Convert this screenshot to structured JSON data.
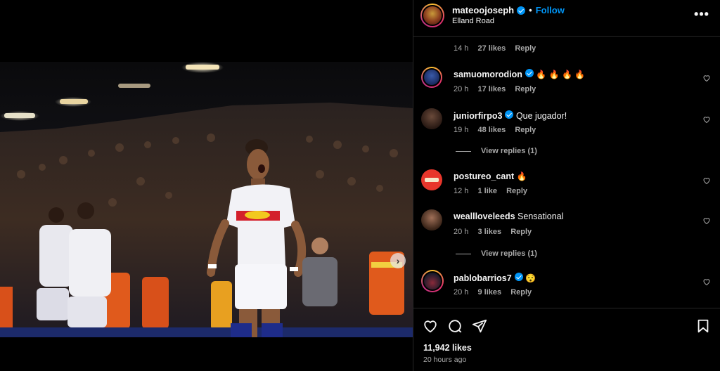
{
  "post": {
    "username": "mateoojoseph",
    "location": "Elland Road",
    "follow_label": "Follow",
    "separator": "•",
    "more_label": "•••",
    "likes_text": "11,942 likes",
    "time_ago": "20 hours ago"
  },
  "media": {
    "next_label": "›",
    "dot_count": 5,
    "active_dot": 0
  },
  "comments": [
    {
      "username": "",
      "text": "",
      "time": "14 h",
      "likes": "27 likes",
      "reply": "Reply",
      "partial": true
    },
    {
      "username": "samuomorodion",
      "verified": true,
      "text": "🔥 🔥 🔥 🔥",
      "time": "20 h",
      "likes": "17 likes",
      "reply": "Reply"
    },
    {
      "username": "juniorfirpo3",
      "verified": true,
      "text": "Que jugador!",
      "time": "19 h",
      "likes": "48 likes",
      "reply": "Reply",
      "view_replies": "View replies (1)"
    },
    {
      "username": "postureo_cant",
      "verified": false,
      "text": "🔥",
      "time": "12 h",
      "likes": "1 like",
      "reply": "Reply"
    },
    {
      "username": "weallloveleeds",
      "verified": false,
      "text": "Sensational",
      "time": "20 h",
      "likes": "3 likes",
      "reply": "Reply",
      "view_replies": "View replies (1)"
    },
    {
      "username": "pablobarrios7",
      "verified": true,
      "text": "😯",
      "time": "20 h",
      "likes": "9 likes",
      "reply": "Reply"
    }
  ],
  "colors": {
    "accent": "#0095f6",
    "secondary_text": "#a8a8a8",
    "divider": "#262626"
  },
  "icons": [
    "heart-icon",
    "comment-icon",
    "share-icon",
    "bookmark-icon",
    "more-icon",
    "chevron-right-icon",
    "verified-icon"
  ]
}
